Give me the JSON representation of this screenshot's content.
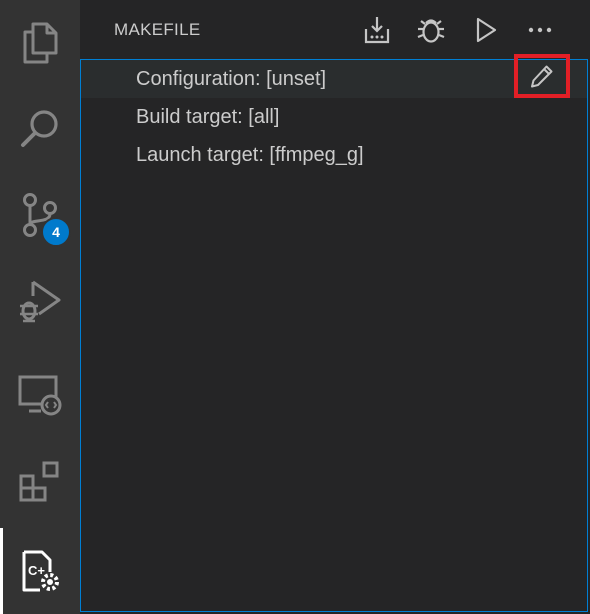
{
  "activity_bar": {
    "items": [
      {
        "name": "explorer",
        "icon": "files-icon"
      },
      {
        "name": "search",
        "icon": "search-icon"
      },
      {
        "name": "source-control",
        "icon": "source-control-icon",
        "badge": "4"
      },
      {
        "name": "run-and-debug",
        "icon": "run-debug-icon"
      },
      {
        "name": "remote-explorer",
        "icon": "remote-explorer-icon"
      },
      {
        "name": "extensions",
        "icon": "extensions-icon"
      },
      {
        "name": "makefile-tools",
        "icon": "makefile-tools-icon",
        "active": true
      }
    ],
    "source_control_badge": "4"
  },
  "panel": {
    "title": "MAKEFILE",
    "actions": [
      "build-icon",
      "debug-icon",
      "run-icon",
      "more-icon"
    ]
  },
  "tree": {
    "items": [
      {
        "label": "Configuration: [unset]",
        "action_icon": "edit-pencil-icon"
      },
      {
        "label": "Build target: [all]"
      },
      {
        "label": "Launch target: [ffmpeg_g]"
      }
    ]
  },
  "colors": {
    "activity_bar_bg": "#333333",
    "sidebar_bg": "#252526",
    "focus_border": "#007fd4",
    "badge": "#007acc",
    "highlight": "#e21f26",
    "text": "#cccccc"
  }
}
